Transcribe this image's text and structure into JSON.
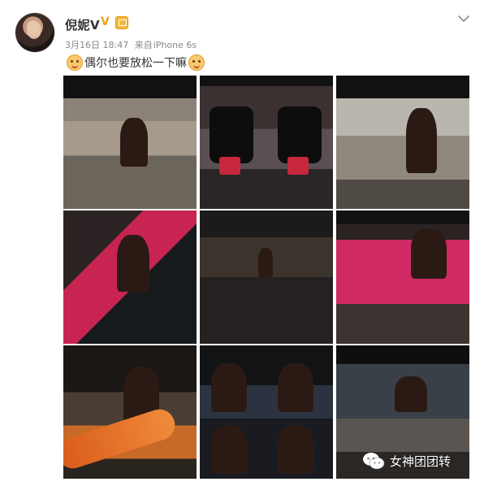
{
  "post": {
    "username": "倪妮V",
    "date": "3月16日 18:47",
    "source_prefix": "来自",
    "source": "iPhone 6s",
    "text": "偶尔也要放松一下嘛",
    "icons": {
      "verified": "verified-v-icon",
      "level": "member-level-icon",
      "menu": "chevron-down-icon",
      "emoji_left": "emoji-icon",
      "emoji_right": "emoji-icon"
    },
    "verified_symbol": "V",
    "photos": [
      {
        "id": "photo-1"
      },
      {
        "id": "photo-2"
      },
      {
        "id": "photo-3"
      },
      {
        "id": "photo-4"
      },
      {
        "id": "photo-5"
      },
      {
        "id": "photo-6"
      },
      {
        "id": "photo-7"
      },
      {
        "id": "photo-8"
      },
      {
        "id": "photo-9"
      }
    ]
  },
  "watermark": {
    "text": "女神团团转",
    "icon": "wechat-icon"
  },
  "colors": {
    "username": "#333333",
    "meta": "#888888",
    "verified": "#f0a417"
  }
}
